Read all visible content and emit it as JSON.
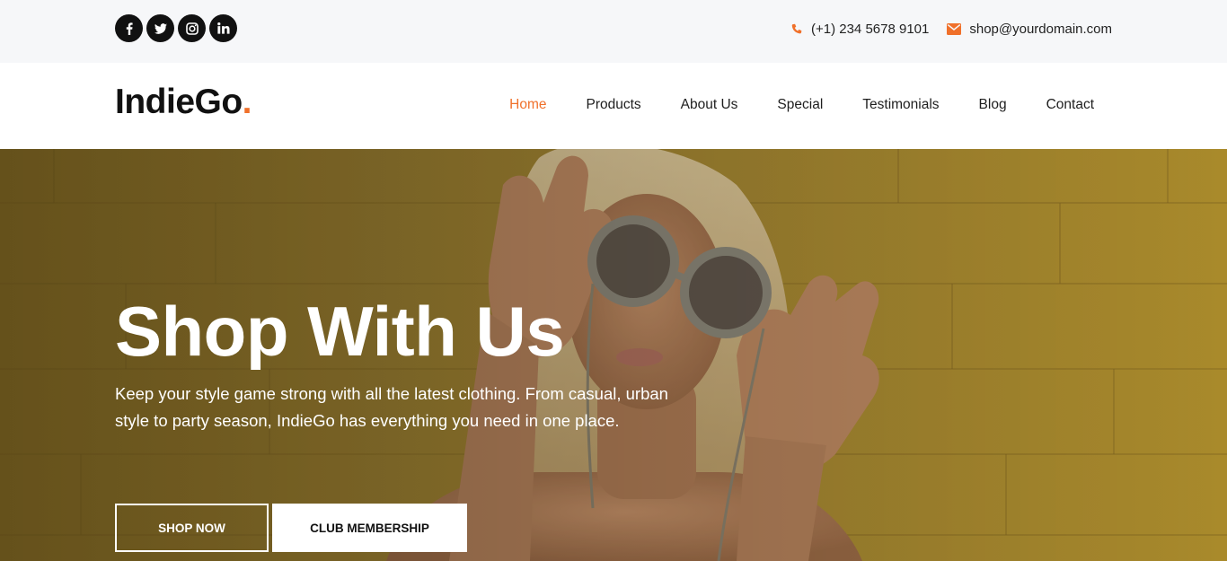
{
  "topbar": {
    "social": [
      {
        "name": "facebook-icon"
      },
      {
        "name": "twitter-icon"
      },
      {
        "name": "instagram-icon"
      },
      {
        "name": "linkedin-icon"
      }
    ],
    "phone": "(+1) 234 5678 9101",
    "email": "shop@yourdomain.com",
    "accent_color": "#f0702a"
  },
  "nav": {
    "logo_text": "IndieGo",
    "logo_dot": ".",
    "items": [
      {
        "label": "Home",
        "active": true
      },
      {
        "label": "Products"
      },
      {
        "label": "About Us"
      },
      {
        "label": "Special"
      },
      {
        "label": "Testimonials"
      },
      {
        "label": "Blog"
      },
      {
        "label": "Contact"
      }
    ]
  },
  "hero": {
    "title": "Shop With Us",
    "description": "Keep your style game strong with all the latest clothing. From casual, urban style to party season, IndieGo has everything you need in one place.",
    "primary_button": "SHOP NOW",
    "secondary_button": "CLUB MEMBERSHIP"
  }
}
